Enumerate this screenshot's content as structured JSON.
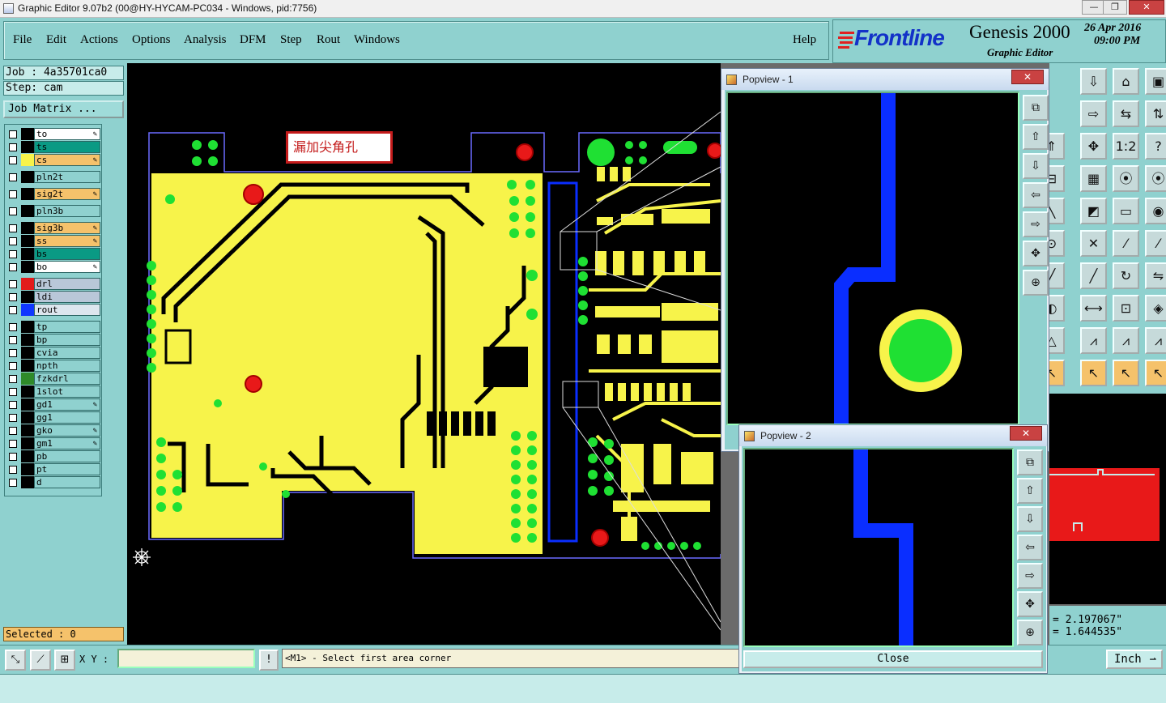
{
  "window": {
    "title": "Graphic Editor 9.07b2 (00@HY-HYCAM-PC034 - Windows, pid:7756)",
    "min": "—",
    "restore": "❐",
    "close": "✕"
  },
  "menu": {
    "items": [
      "File",
      "Edit",
      "Actions",
      "Options",
      "Analysis",
      "DFM",
      "Step",
      "Rout",
      "Windows"
    ],
    "help": "Help"
  },
  "logo": {
    "brand": "Frontline",
    "product": "Genesis 2000",
    "subtitle": "Graphic Editor",
    "date": "26 Apr 2016",
    "time": "09:00 PM"
  },
  "job": {
    "job_label": "Job : 4a35701ca0",
    "step_label": "Step: cam",
    "matrix_button": "Job Matrix ..."
  },
  "layers": [
    {
      "name": "to",
      "color": "#ffffff",
      "swatch": "#000000",
      "edit": true
    },
    {
      "name": "ts",
      "color": "#0a9a84",
      "swatch": "#000000",
      "edit": false
    },
    {
      "name": "cs",
      "color": "#f5c26b",
      "swatch": "#f7f34a",
      "edit": true
    },
    {
      "name": "pln2t",
      "color": "#8fd1cf",
      "swatch": "#000000",
      "edit": false
    },
    {
      "name": "sig2t",
      "color": "#f5c26b",
      "swatch": "#000000",
      "edit": true
    },
    {
      "name": "pln3b",
      "color": "#8fd1cf",
      "swatch": "#000000",
      "edit": false
    },
    {
      "name": "sig3b",
      "color": "#f5c26b",
      "swatch": "#000000",
      "edit": true
    },
    {
      "name": "ss",
      "color": "#f5c26b",
      "swatch": "#000000",
      "edit": true
    },
    {
      "name": "bs",
      "color": "#0a9a84",
      "swatch": "#000000",
      "edit": false
    },
    {
      "name": "bo",
      "color": "#ffffff",
      "swatch": "#000000",
      "edit": true
    },
    {
      "name": "drl",
      "color": "#b9c7d8",
      "swatch": "#e21b1b",
      "edit": false
    },
    {
      "name": "ldi",
      "color": "#b9c7d8",
      "swatch": "#000000",
      "edit": false
    },
    {
      "name": "rout",
      "color": "#dde6ee",
      "swatch": "#1037ff",
      "edit": false
    },
    {
      "name": "tp",
      "color": "#8fd1cf",
      "swatch": "#000000",
      "edit": false
    },
    {
      "name": "bp",
      "color": "#8fd1cf",
      "swatch": "#000000",
      "edit": false
    },
    {
      "name": "cvia",
      "color": "#8fd1cf",
      "swatch": "#000000",
      "edit": false
    },
    {
      "name": "npth",
      "color": "#8fd1cf",
      "swatch": "#000000",
      "edit": false
    },
    {
      "name": "fzkdrl",
      "color": "#8fd1cf",
      "swatch": "#2f8a2a",
      "edit": false
    },
    {
      "name": "1slot",
      "color": "#8fd1cf",
      "swatch": "#000000",
      "edit": false
    },
    {
      "name": "gd1",
      "color": "#8fd1cf",
      "swatch": "#000000",
      "edit": true
    },
    {
      "name": "gg1",
      "color": "#8fd1cf",
      "swatch": "#000000",
      "edit": false
    },
    {
      "name": "gko",
      "color": "#8fd1cf",
      "swatch": "#000000",
      "edit": true
    },
    {
      "name": "gm1",
      "color": "#8fd1cf",
      "swatch": "#000000",
      "edit": true
    },
    {
      "name": "pb",
      "color": "#8fd1cf",
      "swatch": "#000000",
      "edit": false
    },
    {
      "name": "pt",
      "color": "#8fd1cf",
      "swatch": "#000000",
      "edit": false
    },
    {
      "name": "d",
      "color": "#8fd1cf",
      "swatch": "#000000",
      "edit": false
    }
  ],
  "selected": "Selected : 0",
  "annotation": "漏加尖角孔",
  "bottom": {
    "xy_label": "X Y :",
    "xy_value": "",
    "prompt": "<M1> - Select first area corner",
    "alert": "!"
  },
  "coords": {
    "x": "= 2.197067\"",
    "y": "= 1.644535\""
  },
  "units": "Inch",
  "popviews": [
    {
      "title": "Popview - 1",
      "close_label": "Close",
      "close_icon": "✕"
    },
    {
      "title": "Popview - 2",
      "close_label": "Close",
      "close_icon": "✕"
    }
  ],
  "colors": {
    "board": "#f7f34a",
    "pad": "#1fe033",
    "drill": "#e81919",
    "rout": "#0a2eff",
    "background": "#000000",
    "panel": "#8fd1cf"
  }
}
